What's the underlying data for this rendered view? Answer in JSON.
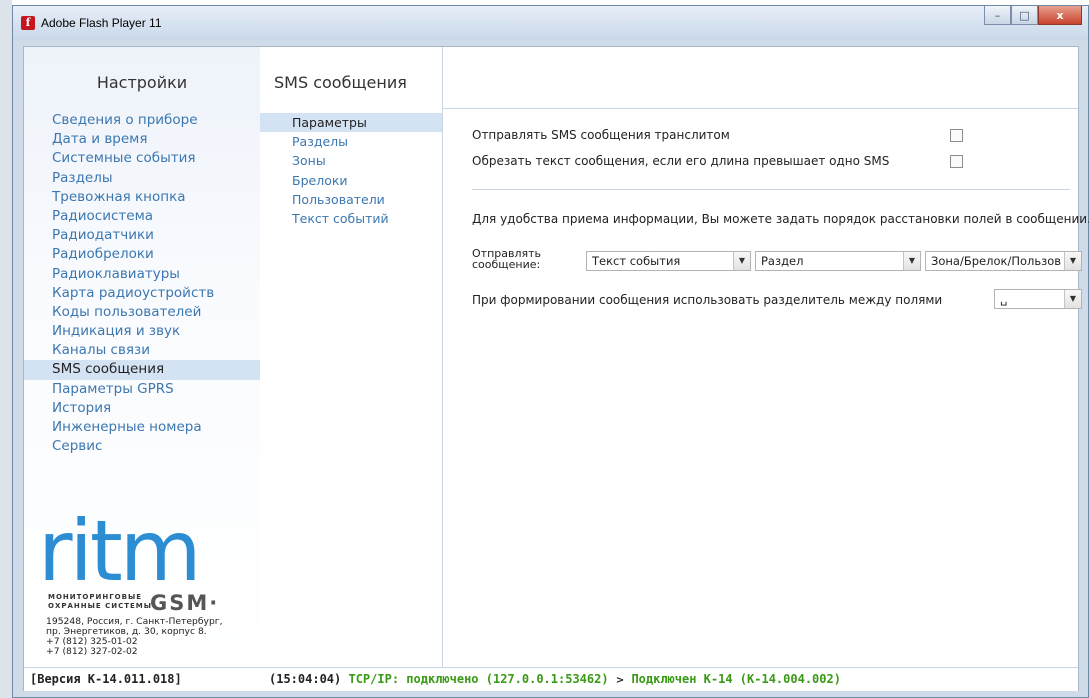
{
  "window": {
    "title": "Adobe Flash Player 11",
    "controls": {
      "minimize": "–",
      "maximize": "□",
      "close": "x"
    }
  },
  "sidebar": {
    "title": "Настройки",
    "items": [
      {
        "label": "Сведения о приборе"
      },
      {
        "label": "Дата и время"
      },
      {
        "label": "Системные события"
      },
      {
        "label": "Разделы"
      },
      {
        "label": "Тревожная кнопка"
      },
      {
        "label": "Радиосистема"
      },
      {
        "label": "Радиодатчики"
      },
      {
        "label": "Радиобрелоки"
      },
      {
        "label": "Радиоклавиатуры"
      },
      {
        "label": "Карта радиоустройств"
      },
      {
        "label": "Коды пользователей"
      },
      {
        "label": "Индикация и звук"
      },
      {
        "label": "Каналы связи"
      },
      {
        "label": "SMS сообщения",
        "active": true
      },
      {
        "label": "Параметры GPRS"
      },
      {
        "label": "История"
      },
      {
        "label": "Инженерные номера"
      },
      {
        "label": "Сервис"
      }
    ],
    "logo": {
      "text": "ritm",
      "subtitle_line1": "МОНИТОРИНГОВЫЕ",
      "subtitle_line2": "ОХРАННЫЕ СИСТЕМЫ",
      "gsm": "GSM·"
    },
    "address": "195248, Россия, г. Санкт-Петербург,\nпр. Энергетиков, д. 30, корпус 8.\n+7 (812) 325-01-02\n+7 (812) 327-02-02"
  },
  "subpanel": {
    "title": "SMS сообщения",
    "items": [
      {
        "label": "Параметры",
        "active": true
      },
      {
        "label": "Разделы"
      },
      {
        "label": "Зоны"
      },
      {
        "label": "Брелоки"
      },
      {
        "label": "Пользователи"
      },
      {
        "label": "Текст событий"
      }
    ]
  },
  "content": {
    "option_translit": {
      "label": "Отправлять SMS сообщения транслитом",
      "checked": false
    },
    "option_truncate": {
      "label": "Обрезать текст сообщения, если его длина превышает одно SMS",
      "checked": false
    },
    "info_text": "Для удобства приема информации, Вы можете задать порядок расстановки полей в сообщении.",
    "send_label_line1": "Отправлять",
    "send_label_line2": "сообщение:",
    "field1": "Текст события",
    "field2": "Раздел",
    "field3": "Зона/Брелок/Пользов",
    "separator_label": "При формировании сообщения использовать разделитель между полями",
    "separator_value": "␣"
  },
  "status": {
    "version": "[Версия К-14.011.018]",
    "time": "(15:04:04)",
    "tcp": "TCP/IP: подключено (127.0.0.1:53462)",
    "arrow": ">",
    "connected": "Подключен К-14 (К-14.004.002)"
  }
}
